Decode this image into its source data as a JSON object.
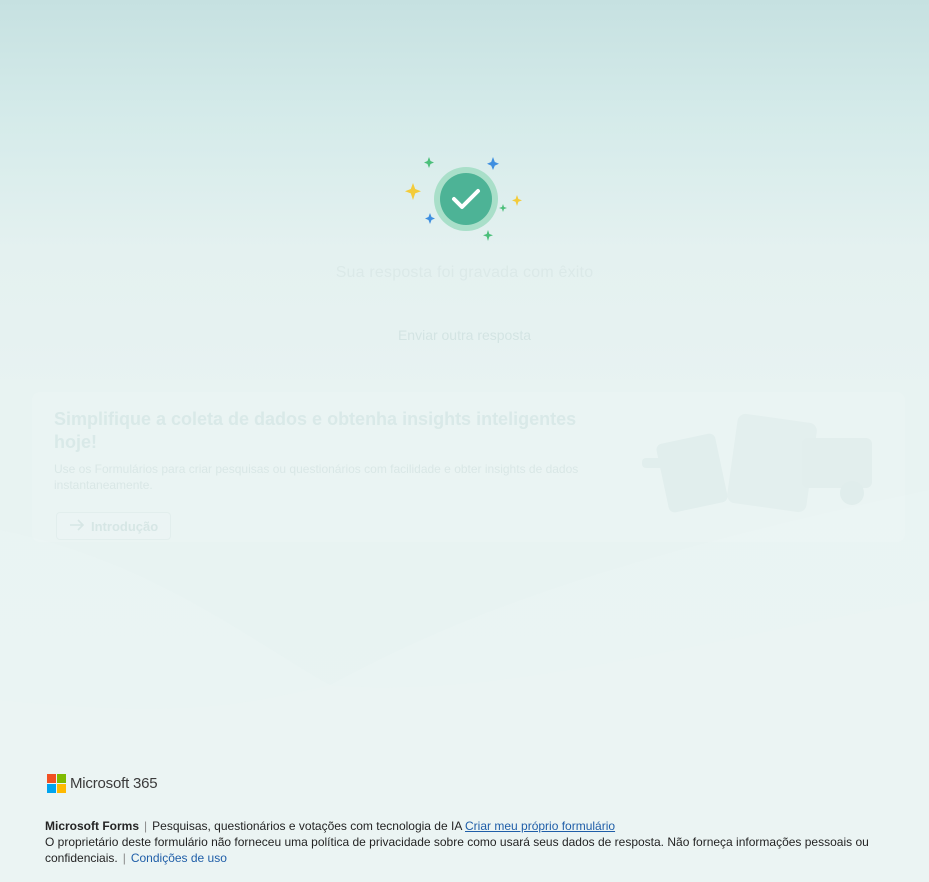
{
  "success": {
    "message": "Sua resposta foi gravada com êxito",
    "another_response": "Enviar outra resposta"
  },
  "promo": {
    "title": "Simplifique a coleta de dados e obtenha insights inteligentes hoje!",
    "description": "Use os Formulários para criar pesquisas ou questionários com facilidade e obter insights de dados instantaneamente.",
    "button_label": "Introdução"
  },
  "footer": {
    "brand": "Microsoft 365",
    "product": "Microsoft Forms",
    "tagline": "Pesquisas, questionários e votações com tecnologia de IA",
    "create_link": "Criar meu próprio formulário",
    "privacy_notice": "O proprietário deste formulário não forneceu uma política de privacidade sobre como usará seus dados de resposta. Não forneça informações pessoais ou confidenciais.",
    "terms_link": "Condições de uso"
  },
  "colors": {
    "ms_red": "#f25022",
    "ms_green": "#7fba00",
    "ms_blue": "#00a4ef",
    "ms_yellow": "#ffb900",
    "check_green": "#4db396",
    "link_blue": "#1f5ea8"
  },
  "icons": [
    "checkmark-circle-icon",
    "sparkle-icon",
    "arrow-right-icon",
    "microsoft-logo-icon"
  ]
}
